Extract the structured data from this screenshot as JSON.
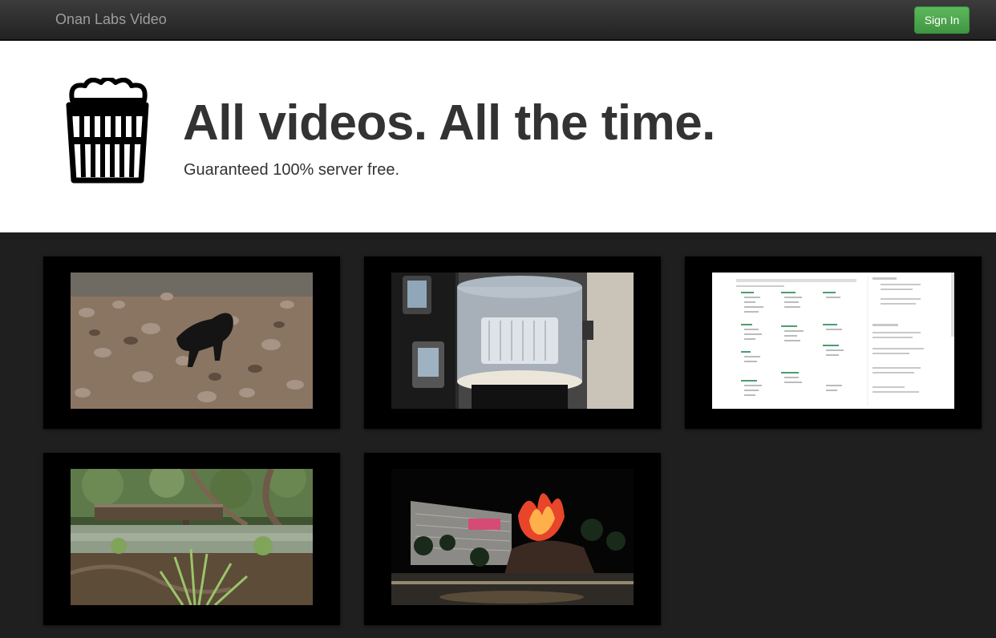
{
  "navbar": {
    "brand": "Onan Labs Video",
    "signin_label": "Sign In"
  },
  "hero": {
    "headline": "All videos. All the time.",
    "tagline": "Guaranteed 100% server free.",
    "logo_icon": "popcorn-icon"
  },
  "videos": [
    {
      "thumbnail": "dog on rocky riverbank"
    },
    {
      "thumbnail": "glass display case with luggage"
    },
    {
      "thumbnail": "web console screenshot"
    },
    {
      "thumbnail": "creek with wooden bridge"
    },
    {
      "thumbnail": "volcano fountain at night"
    }
  ],
  "colors": {
    "navbar": "#2a2a2a",
    "brand_text": "#9d9d9d",
    "signin": "#4cae4c",
    "page_bg": "#1f1f1f",
    "tile_bg": "#000000"
  }
}
